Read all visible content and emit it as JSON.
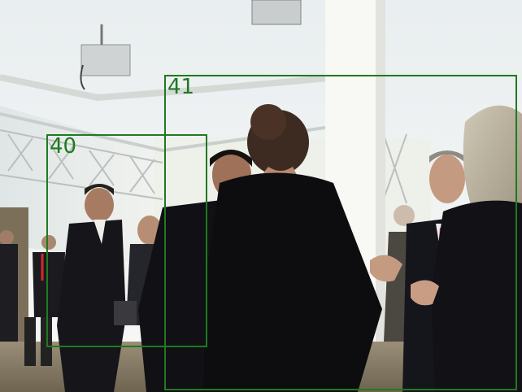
{
  "detections": [
    {
      "id": "40",
      "label": "40",
      "color": "#1f7a1f"
    },
    {
      "id": "41",
      "label": "41",
      "color": "#1f7a1f"
    }
  ]
}
